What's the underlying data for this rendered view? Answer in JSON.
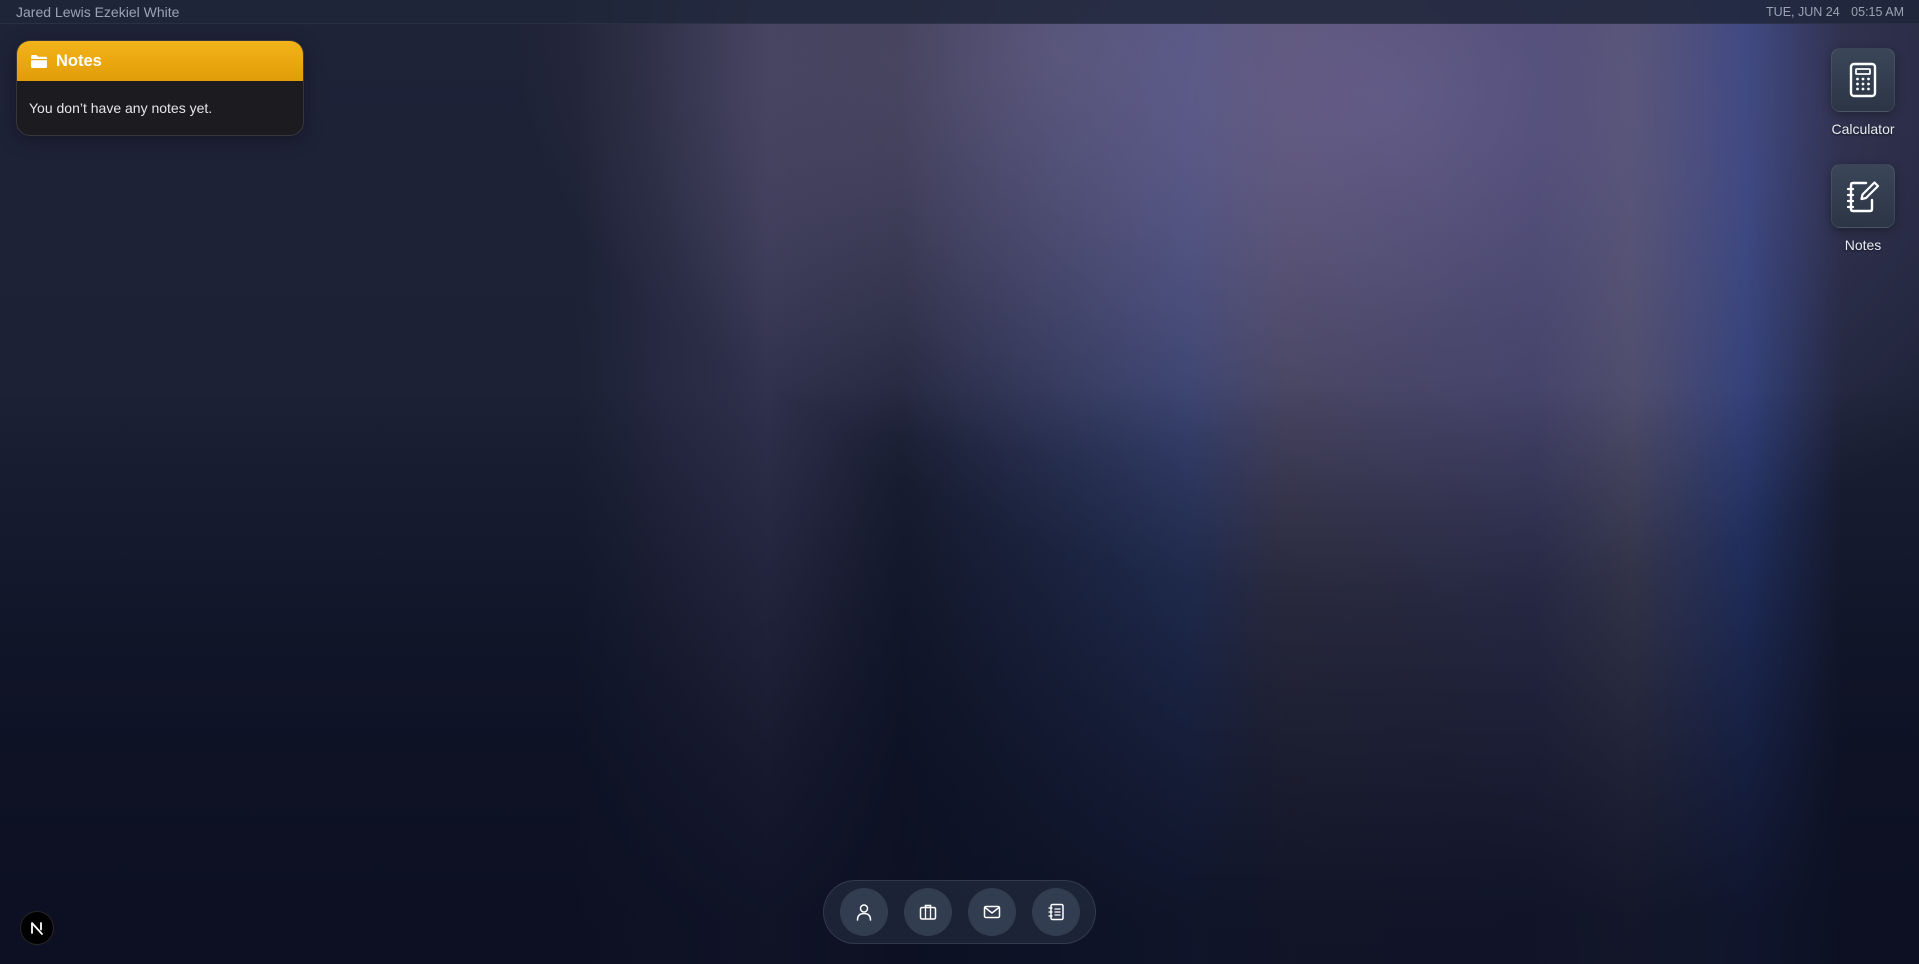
{
  "topbar": {
    "user_name": "Jared Lewis Ezekiel White",
    "date": "TUE, JUN 24",
    "time": "05:15 AM"
  },
  "notes_widget": {
    "icon": "folder-icon",
    "title": "Notes",
    "empty_message": "You don’t have any notes yet.",
    "accent_color": "#f0a812"
  },
  "desktop_icons": [
    {
      "icon": "calculator-icon",
      "label": "Calculator"
    },
    {
      "icon": "notes-edit-icon",
      "label": "Notes"
    }
  ],
  "dock": {
    "items": [
      {
        "icon": "user-icon"
      },
      {
        "icon": "briefcase-icon"
      },
      {
        "icon": "mail-icon"
      },
      {
        "icon": "contacts-book-icon"
      }
    ]
  },
  "corner_logo": {
    "icon": "n-logo-icon",
    "letter": "N"
  }
}
